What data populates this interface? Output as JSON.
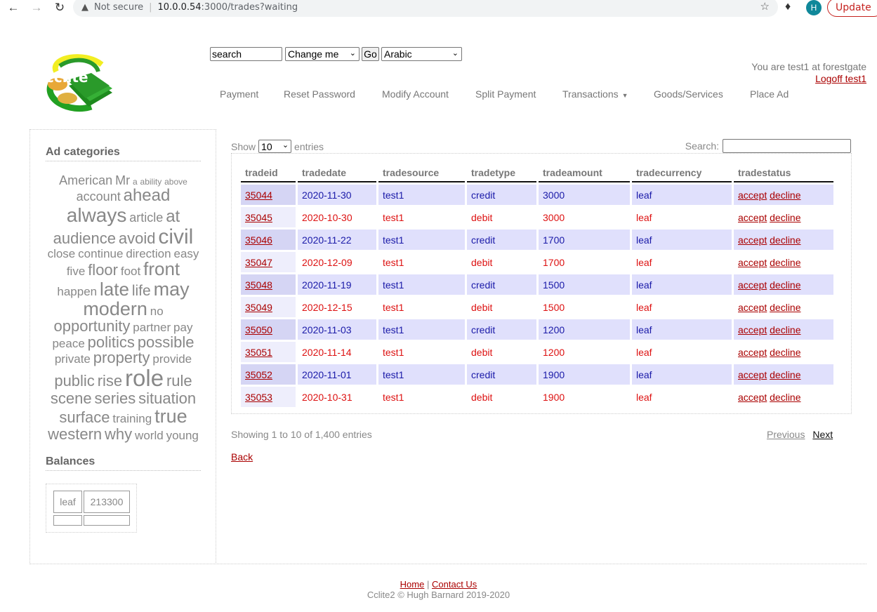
{
  "browser": {
    "security_label": "Not secure",
    "url_host": "10.0.0.54",
    "url_path": ":3000/trades?waiting",
    "profile_initial": "H",
    "update_label": "Update"
  },
  "header": {
    "logo_text": "cclite",
    "search_value": "search",
    "type_select_value": "Change me",
    "go_label": "Go",
    "language_select_value": "Arabic",
    "user_text": "You are test1 at forestgate",
    "logoff_label": "Logoff test1",
    "menu": [
      {
        "label": "Payment"
      },
      {
        "label": "Reset Password"
      },
      {
        "label": "Modify Account"
      },
      {
        "label": "Split Payment"
      },
      {
        "label": "Transactions",
        "has_dropdown": true
      },
      {
        "label": "Goods/Services"
      },
      {
        "label": "Place Ad"
      }
    ]
  },
  "sidebar": {
    "ad_categories_title": "Ad categories",
    "tags": [
      {
        "word": "American",
        "size": 18
      },
      {
        "word": "Mr",
        "size": 18
      },
      {
        "word": "a",
        "size": 12
      },
      {
        "word": "ability",
        "size": 12
      },
      {
        "word": "above",
        "size": 12
      },
      {
        "word": "account",
        "size": 18
      },
      {
        "word": "ahead",
        "size": 24
      },
      {
        "word": "always",
        "size": 28
      },
      {
        "word": "article",
        "size": 18
      },
      {
        "word": "at",
        "size": 24
      },
      {
        "word": "audience",
        "size": 22
      },
      {
        "word": "avoid",
        "size": 22
      },
      {
        "word": "civil",
        "size": 30
      },
      {
        "word": "close",
        "size": 17
      },
      {
        "word": "continue",
        "size": 17
      },
      {
        "word": "direction",
        "size": 17
      },
      {
        "word": "easy",
        "size": 17
      },
      {
        "word": "five",
        "size": 17
      },
      {
        "word": "floor",
        "size": 22
      },
      {
        "word": "foot",
        "size": 17
      },
      {
        "word": "front",
        "size": 26
      },
      {
        "word": "happen",
        "size": 17
      },
      {
        "word": "late",
        "size": 26
      },
      {
        "word": "life",
        "size": 21
      },
      {
        "word": "may",
        "size": 27
      },
      {
        "word": "modern",
        "size": 27
      },
      {
        "word": "no",
        "size": 17
      },
      {
        "word": "opportunity",
        "size": 22
      },
      {
        "word": "partner",
        "size": 17
      },
      {
        "word": "pay",
        "size": 17
      },
      {
        "word": "peace",
        "size": 17
      },
      {
        "word": "politics",
        "size": 22
      },
      {
        "word": "possible",
        "size": 22
      },
      {
        "word": "private",
        "size": 17
      },
      {
        "word": "property",
        "size": 22
      },
      {
        "word": "provide",
        "size": 17
      },
      {
        "word": "public",
        "size": 22
      },
      {
        "word": "rise",
        "size": 22
      },
      {
        "word": "role",
        "size": 33
      },
      {
        "word": "rule",
        "size": 22
      },
      {
        "word": "scene",
        "size": 22
      },
      {
        "word": "series",
        "size": 22
      },
      {
        "word": "situation",
        "size": 22
      },
      {
        "word": "surface",
        "size": 22
      },
      {
        "word": "training",
        "size": 17
      },
      {
        "word": "true",
        "size": 27
      },
      {
        "word": "western",
        "size": 22
      },
      {
        "word": "why",
        "size": 22
      },
      {
        "word": "world",
        "size": 17
      },
      {
        "word": "young",
        "size": 17
      }
    ],
    "balances_title": "Balances",
    "balances": [
      {
        "currency": "leaf",
        "amount": "213300"
      },
      {
        "currency": "",
        "amount": ""
      }
    ]
  },
  "main": {
    "show_label": "Show",
    "entries_label": "entries",
    "page_length": "10",
    "search_label": "Search:",
    "search_value": "",
    "columns": [
      "tradeid",
      "tradedate",
      "tradesource",
      "tradetype",
      "tradeamount",
      "tradecurrency",
      "tradestatus"
    ],
    "rows": [
      {
        "tradeid": "35044",
        "tradedate": "2020-11-30",
        "tradesource": "test1",
        "tradetype": "credit",
        "tradeamount": "3000",
        "tradecurrency": "leaf",
        "accept": "accept",
        "decline": "decline"
      },
      {
        "tradeid": "35045",
        "tradedate": "2020-10-30",
        "tradesource": "test1",
        "tradetype": "debit",
        "tradeamount": "3000",
        "tradecurrency": "leaf",
        "accept": "accept",
        "decline": "decline"
      },
      {
        "tradeid": "35046",
        "tradedate": "2020-11-22",
        "tradesource": "test1",
        "tradetype": "credit",
        "tradeamount": "1700",
        "tradecurrency": "leaf",
        "accept": "accept",
        "decline": "decline"
      },
      {
        "tradeid": "35047",
        "tradedate": "2020-12-09",
        "tradesource": "test1",
        "tradetype": "debit",
        "tradeamount": "1700",
        "tradecurrency": "leaf",
        "accept": "accept",
        "decline": "decline"
      },
      {
        "tradeid": "35048",
        "tradedate": "2020-11-19",
        "tradesource": "test1",
        "tradetype": "credit",
        "tradeamount": "1500",
        "tradecurrency": "leaf",
        "accept": "accept",
        "decline": "decline"
      },
      {
        "tradeid": "35049",
        "tradedate": "2020-12-15",
        "tradesource": "test1",
        "tradetype": "debit",
        "tradeamount": "1500",
        "tradecurrency": "leaf",
        "accept": "accept",
        "decline": "decline"
      },
      {
        "tradeid": "35050",
        "tradedate": "2020-11-03",
        "tradesource": "test1",
        "tradetype": "credit",
        "tradeamount": "1200",
        "tradecurrency": "leaf",
        "accept": "accept",
        "decline": "decline"
      },
      {
        "tradeid": "35051",
        "tradedate": "2020-11-14",
        "tradesource": "test1",
        "tradetype": "debit",
        "tradeamount": "1200",
        "tradecurrency": "leaf",
        "accept": "accept",
        "decline": "decline"
      },
      {
        "tradeid": "35052",
        "tradedate": "2020-11-01",
        "tradesource": "test1",
        "tradetype": "credit",
        "tradeamount": "1900",
        "tradecurrency": "leaf",
        "accept": "accept",
        "decline": "decline"
      },
      {
        "tradeid": "35053",
        "tradedate": "2020-10-31",
        "tradesource": "test1",
        "tradetype": "debit",
        "tradeamount": "1900",
        "tradecurrency": "leaf",
        "accept": "accept",
        "decline": "decline"
      }
    ],
    "info_text": "Showing 1 to 10 of 1,400 entries",
    "previous_label": "Previous",
    "next_label": "Next",
    "back_label": "Back"
  },
  "footer": {
    "home_label": "Home",
    "separator": "|",
    "contact_label": "Contact Us",
    "copyright": "Cclite2 © Hugh Barnard 2019-2020"
  },
  "colors": {
    "credit_text": "#1a1aa8",
    "debit_text": "#dd1111",
    "credit_row_bg": "#e0e0fc",
    "link": "#aa0000"
  }
}
